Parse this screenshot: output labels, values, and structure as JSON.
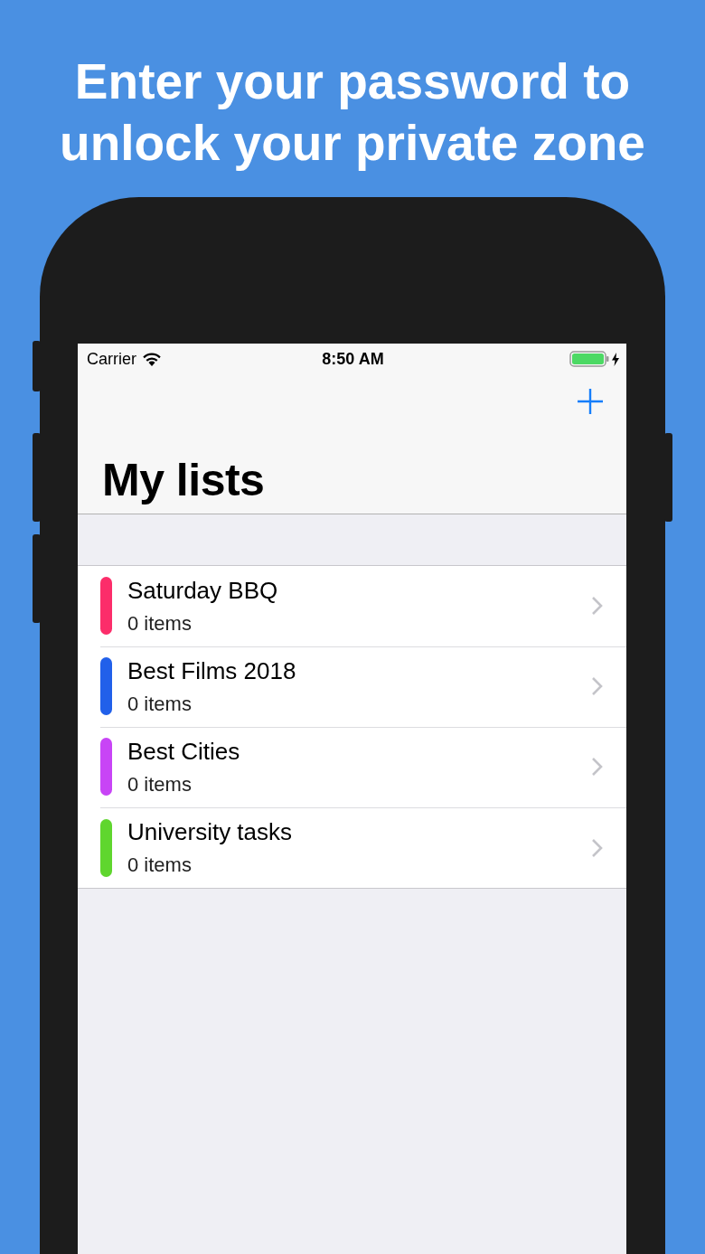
{
  "headline": "Enter your password to unlock your private zone",
  "status_bar": {
    "carrier": "Carrier",
    "time": "8:50 AM",
    "charging": true
  },
  "navigation": {
    "title": "My lists"
  },
  "lists": [
    {
      "name": "Saturday BBQ",
      "count": "0 items",
      "color": "#fc2d6a"
    },
    {
      "name": "Best Films 2018",
      "count": "0 items",
      "color": "#2160ea"
    },
    {
      "name": "Best Cities",
      "count": "0 items",
      "color": "#c844f6"
    },
    {
      "name": "University tasks",
      "count": "0 items",
      "color": "#5fd62e"
    }
  ]
}
